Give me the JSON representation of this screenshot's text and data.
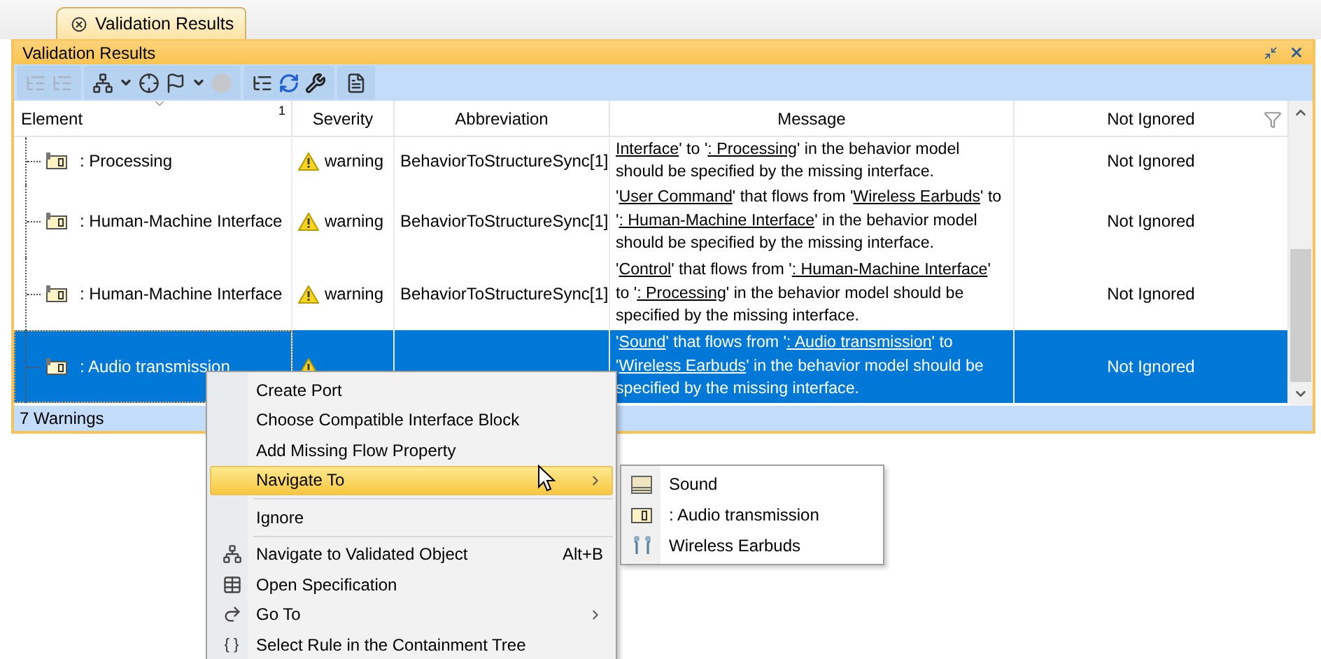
{
  "tab": {
    "label": "Validation Results",
    "selected": true
  },
  "panel": {
    "title": "Validation Results"
  },
  "table": {
    "columns": [
      {
        "label": "Element",
        "sort_order": "1"
      },
      {
        "label": "Severity"
      },
      {
        "label": "Abbreviation"
      },
      {
        "label": "Message"
      },
      {
        "label": "Not Ignored",
        "filter": true
      }
    ],
    "rows": [
      {
        "element": ": Processing",
        "severity": "warning",
        "abbreviation": "BehaviorToStructureSync[1]",
        "message": [
          {
            "text": "Interface",
            "link": true
          },
          {
            "text": "' to '"
          },
          {
            "text": ": Processing",
            "link": true
          },
          {
            "text": "' in the behavior model should be specified by the missing interface."
          }
        ],
        "ignored": "Not Ignored",
        "selected": false
      },
      {
        "element": ": Human-Machine Interface",
        "severity": "warning",
        "abbreviation": "BehaviorToStructureSync[1]",
        "message": [
          {
            "text": "'"
          },
          {
            "text": "User Command",
            "link": true
          },
          {
            "text": "' that flows from '"
          },
          {
            "text": "Wireless Earbuds",
            "link": true
          },
          {
            "text": "' to '"
          },
          {
            "text": ": Human-Machine Interface",
            "link": true
          },
          {
            "text": "' in the behavior model should be specified by the missing interface."
          }
        ],
        "ignored": "Not Ignored",
        "selected": false
      },
      {
        "element": ": Human-Machine Interface",
        "severity": "warning",
        "abbreviation": "BehaviorToStructureSync[1]",
        "message": [
          {
            "text": "'"
          },
          {
            "text": "Control",
            "link": true
          },
          {
            "text": "' that flows from '"
          },
          {
            "text": ": Human-Machine Interface",
            "link": true
          },
          {
            "text": "' to '"
          },
          {
            "text": ": Processing",
            "link": true
          },
          {
            "text": "' in the behavior model should be specified by the missing interface."
          }
        ],
        "ignored": "Not Ignored",
        "selected": false
      },
      {
        "element": ": Audio transmission",
        "message": [
          {
            "text": "'"
          },
          {
            "text": "Sound",
            "link": true
          },
          {
            "text": "' that flows from '"
          },
          {
            "text": ": Audio transmission",
            "link": true
          },
          {
            "text": "' to '"
          },
          {
            "text": "Wireless Earbuds",
            "link": true
          },
          {
            "text": "' in the behavior model should be specified by the missing interface."
          }
        ],
        "ignored": "Not Ignored",
        "selected": true
      }
    ]
  },
  "status_bar": "7 Warnings",
  "context_menu": {
    "items": [
      {
        "kind": "item",
        "label": "Create Port",
        "selected": false
      },
      {
        "kind": "item",
        "label": "Choose Compatible Interface Block",
        "selected": false
      },
      {
        "kind": "item",
        "label": "Add Missing Flow Property",
        "selected": false
      },
      {
        "kind": "item",
        "label": "Navigate To",
        "submenu": true,
        "selected": true
      },
      {
        "kind": "separator"
      },
      {
        "kind": "item",
        "label": "Ignore",
        "selected": false
      },
      {
        "kind": "separator"
      },
      {
        "kind": "item",
        "label": "Navigate to Validated Object",
        "shortcut": "Alt+B",
        "selected": false
      },
      {
        "kind": "item",
        "label": "Open Specification",
        "selected": false
      },
      {
        "kind": "item",
        "label": "Go To",
        "submenu": true,
        "selected": false
      },
      {
        "kind": "item",
        "label": "Select Rule in the Containment Tree",
        "glyph": "{ }",
        "selected": false
      }
    ]
  },
  "submenu": {
    "items": [
      {
        "label": "Sound"
      },
      {
        "label": ": Audio transmission"
      },
      {
        "label": "Wireless Earbuds"
      }
    ]
  }
}
